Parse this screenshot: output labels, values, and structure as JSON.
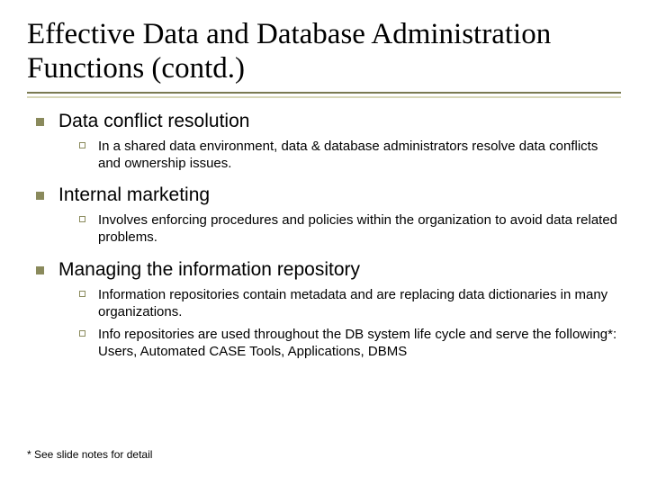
{
  "title": "Effective Data and Database Administration Functions (contd.)",
  "sections": [
    {
      "heading": "Data conflict resolution",
      "items": [
        "In a shared data environment, data & database administrators resolve data conflicts and ownership issues."
      ]
    },
    {
      "heading": "Internal marketing",
      "items": [
        "Involves enforcing procedures and policies within the organization to avoid data related problems."
      ]
    },
    {
      "heading": "Managing the information repository",
      "items": [
        "Information repositories contain metadata and are replacing data dictionaries in many organizations.",
        "Info repositories are used throughout the DB system life cycle and serve the following*: Users, Automated CASE Tools, Applications, DBMS"
      ]
    }
  ],
  "footnote": "* See slide notes for detail"
}
